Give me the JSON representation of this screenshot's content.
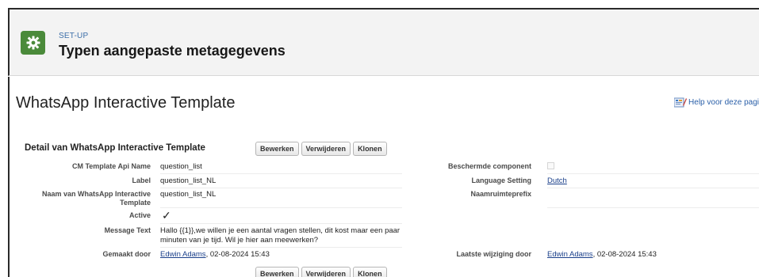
{
  "header": {
    "eyebrow": "SET-UP",
    "title": "Typen aangepaste metagegevens",
    "icon": "gear-icon"
  },
  "page": {
    "title": "WhatsApp Interactive Template",
    "help_link": "Help voor deze pagi"
  },
  "detail": {
    "section_title": "Detail van WhatsApp Interactive Template",
    "buttons": {
      "edit": "Bewerken",
      "delete": "Verwijderen",
      "clone": "Klonen"
    },
    "fields": {
      "api_name_label": "CM Template Api Name",
      "api_name_value": "question_list",
      "label_label": "Label",
      "label_value": "question_list_NL",
      "name_label": "Naam van WhatsApp Interactive Template",
      "name_value": "question_list_NL",
      "active_label": "Active",
      "active_value": "✓",
      "message_label": "Message Text",
      "message_value": "Hallo {{1}},we willen je een aantal vragen stellen, dit kost maar een paar minuten van je tijd. Wil je hier aan meewerken?",
      "created_label": "Gemaakt door",
      "created_by": "Edwin Adams",
      "created_date": ", 02-08-2024 15:43",
      "protected_label": "Beschermde component",
      "language_label": "Language Setting",
      "language_value": "Dutch",
      "namespace_label": "Naamruimteprefix",
      "modified_label": "Laatste wijziging door",
      "modified_by": "Edwin Adams",
      "modified_date": ", 02-08-2024 15:43"
    }
  },
  "colors": {
    "setup_icon_bg": "#4a8a3a",
    "link": "#1a3f8a",
    "eyebrow": "#3c6ea8"
  }
}
